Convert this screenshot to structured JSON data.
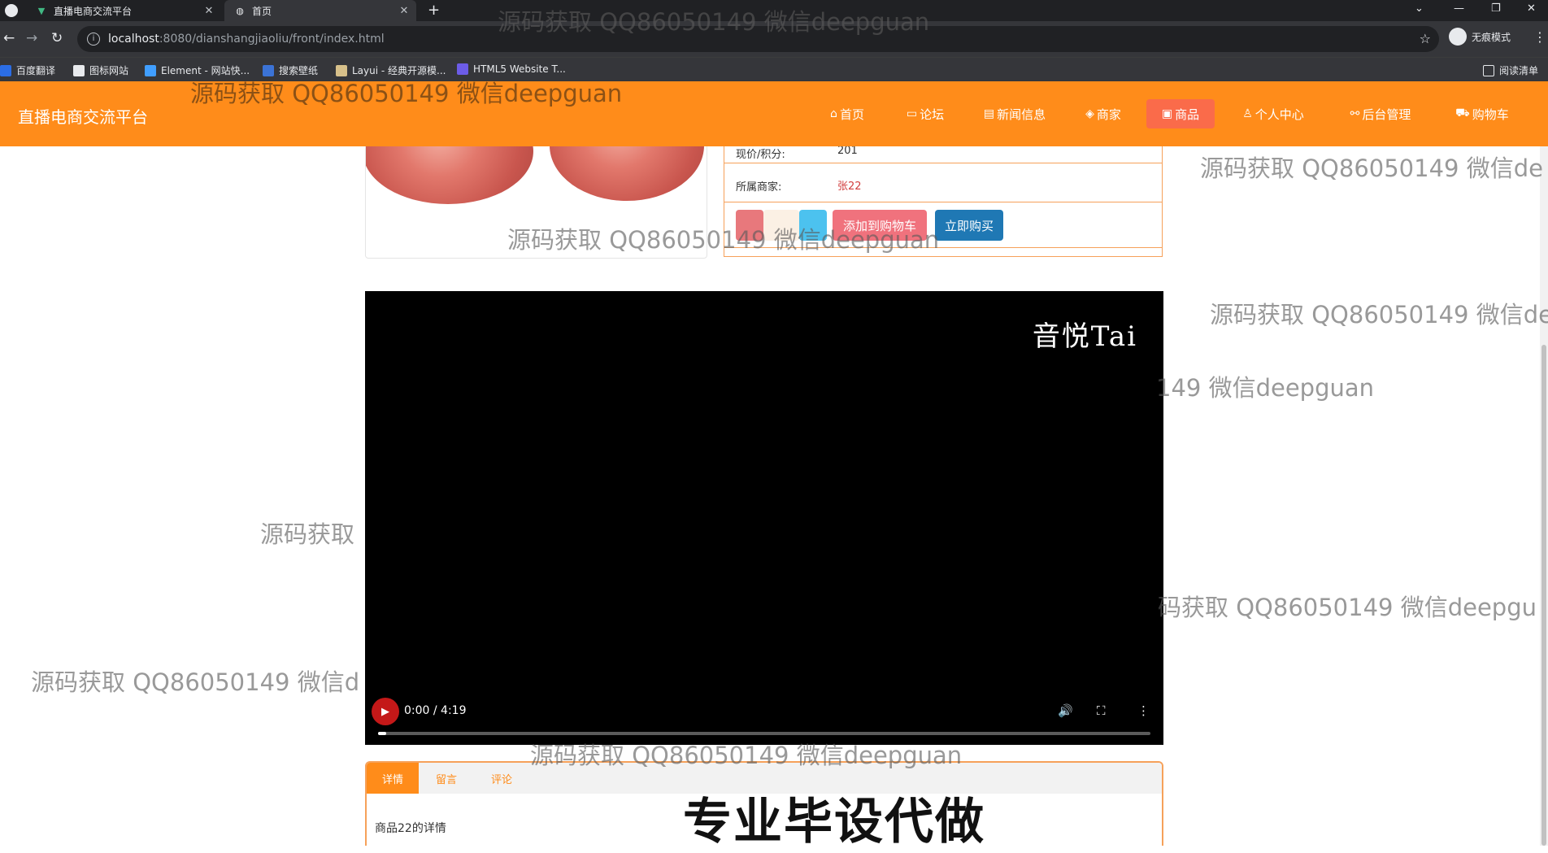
{
  "browser": {
    "tabs": [
      {
        "title": "直播电商交流平台",
        "active": false
      },
      {
        "title": "首页",
        "active": true
      }
    ],
    "url_host": "localhost",
    "url_rest": ":8080/dianshangjiaoliu/front/index.html",
    "incognito_label": "无痕模式",
    "bookmarks": [
      "百度翻译",
      "图标网站",
      "Element - 网站快...",
      "搜索壁纸",
      "Layui - 经典开源模...",
      "HTML5 Website T..."
    ],
    "reading_list": "阅读清单"
  },
  "site": {
    "brand": "直播电商交流平台",
    "nav": [
      {
        "label": "首页",
        "icon": "home-icon",
        "glyph": "⌂"
      },
      {
        "label": "论坛",
        "icon": "forum-icon",
        "glyph": "▭"
      },
      {
        "label": "新闻信息",
        "icon": "news-icon",
        "glyph": "▤"
      },
      {
        "label": "商家",
        "icon": "shop-icon",
        "glyph": "◈"
      },
      {
        "label": "商品",
        "icon": "goods-icon",
        "glyph": "▣",
        "active": true
      },
      {
        "label": "个人中心",
        "icon": "user-icon",
        "glyph": "♙"
      },
      {
        "label": "后台管理",
        "icon": "link-icon",
        "glyph": "⚯"
      },
      {
        "label": "购物车",
        "icon": "cart-icon",
        "glyph": "⛟"
      }
    ],
    "accent_color": "#ff8c1a"
  },
  "product": {
    "price_label": "现价/积分:",
    "price_value": "201",
    "merchant_label": "所属商家:",
    "merchant_value": "张22",
    "add_cart_label": "添加到购物车",
    "buy_label": "立即购买"
  },
  "video": {
    "logo": "音悦Tai",
    "time": "0:00 / 4:19",
    "progress": 0.01
  },
  "detail_tabs": [
    "详情",
    "留言",
    "评论"
  ],
  "detail_text": "商品22的详情",
  "watermark": "源码获取 QQ86050149 微信deepguan",
  "watermark_fragments": [
    "源码获取",
    "源码获取 QQ86050149 微信de",
    "149 微信deepguan",
    "码获取 QQ86050149 微信deepgu",
    "源码获取 QQ86050149 微信d"
  ],
  "banner": "专业毕设代做"
}
